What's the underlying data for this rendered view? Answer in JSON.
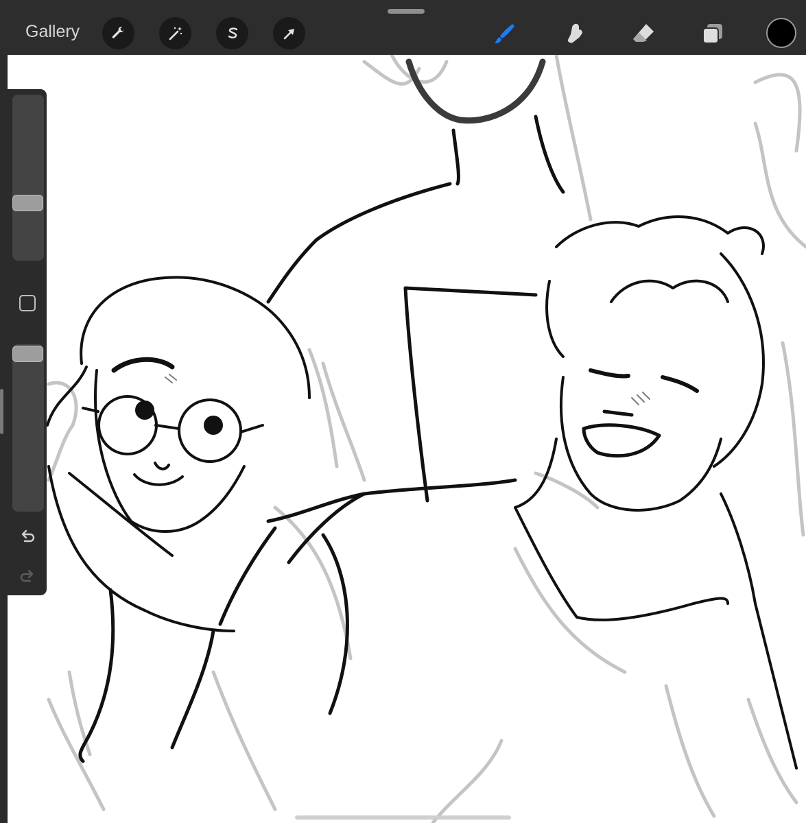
{
  "toolbar": {
    "gallery_label": "Gallery",
    "left_tools": [
      "wrench-icon",
      "magic-wand-icon",
      "selection-s-icon",
      "arrow-cursor-icon"
    ],
    "right_tools": [
      "brush-icon",
      "smudge-icon",
      "eraser-icon",
      "layers-icon"
    ],
    "active_tool": "brush-icon",
    "active_color": "#1e7bf5",
    "current_color": "#000000"
  },
  "sidebar": {
    "brush_size_level": 0.65,
    "opacity_level": 1.0,
    "undo": "undo-icon",
    "redo": "redo-icon"
  },
  "canvas": {
    "content": "sketch"
  }
}
